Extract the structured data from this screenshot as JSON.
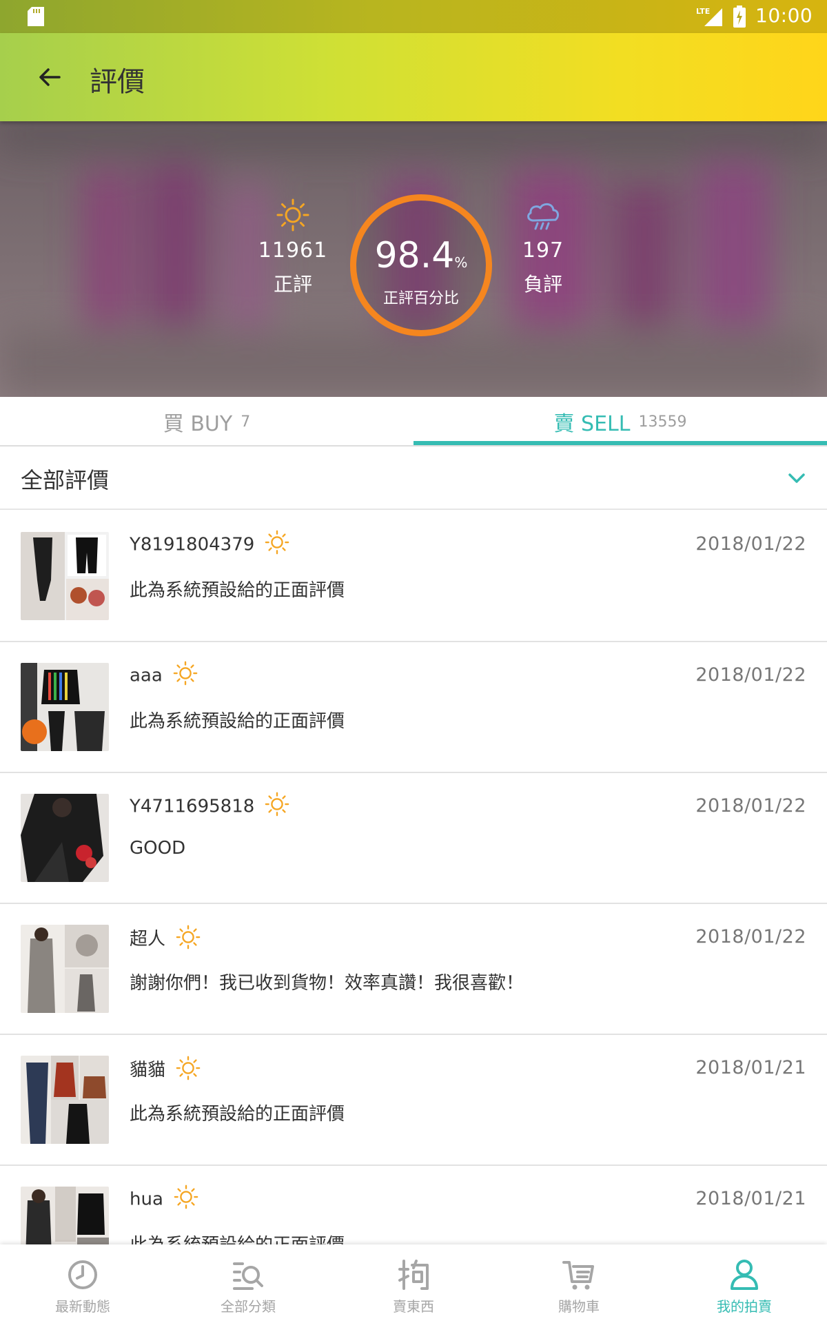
{
  "status_bar": {
    "time": "10:00",
    "network": "LTE"
  },
  "app_bar": {
    "title": "評價"
  },
  "summary": {
    "positive_count": "11961",
    "positive_label": "正評",
    "percent_value": "98.4",
    "percent_unit": "%",
    "percent_label": "正評百分比",
    "negative_count": "197",
    "negative_label": "負評"
  },
  "tabs": [
    {
      "label": "買 BUY",
      "count": "7",
      "selected": false
    },
    {
      "label": "賣 SELL",
      "count": "13559",
      "selected": true
    }
  ],
  "filter": {
    "label": "全部評價"
  },
  "reviews": [
    {
      "user": "Y8191804379",
      "date": "2018/01/22",
      "comment": "此為系統預設給的正面評價"
    },
    {
      "user": "aaa",
      "date": "2018/01/22",
      "comment": "此為系統預設給的正面評價"
    },
    {
      "user": "Y4711695818",
      "date": "2018/01/22",
      "comment": "GOOD"
    },
    {
      "user": "超人",
      "date": "2018/01/22",
      "comment": "謝謝你們！我已收到貨物！效率真讚！我很喜歡！"
    },
    {
      "user": "貓貓",
      "date": "2018/01/21",
      "comment": "此為系統預設給的正面評價"
    },
    {
      "user": "hua",
      "date": "2018/01/21",
      "comment": "此為系統預設給的正面評價"
    }
  ],
  "bottom_nav": [
    {
      "label": "最新動態",
      "icon": "clock-icon",
      "active": false
    },
    {
      "label": "全部分類",
      "icon": "category-search-icon",
      "active": false
    },
    {
      "label": "賣東西",
      "icon": "sell-icon",
      "active": false
    },
    {
      "label": "購物車",
      "icon": "cart-icon",
      "active": false
    },
    {
      "label": "我的拍賣",
      "icon": "user-icon",
      "active": true
    }
  ],
  "colors": {
    "accent": "#35bcb3",
    "ring": "#f5861f",
    "sun": "#f5a623",
    "rain": "#7fa7e0"
  }
}
